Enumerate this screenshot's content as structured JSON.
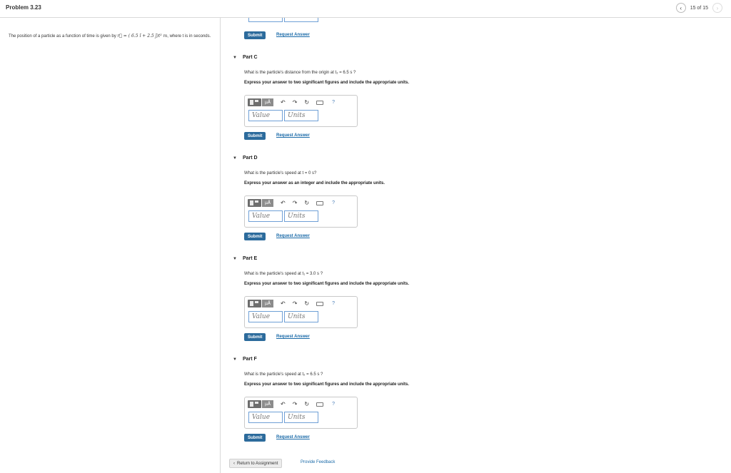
{
  "header": {
    "title": "Problem 3.23",
    "nav_prev": "‹",
    "nav_count": "15 of 15",
    "nav_next": "›"
  },
  "problem": {
    "text_before": "The position of a particle as a function of time is given by ",
    "equation": "r⃗ = ( 6.5 î + 2.5 ĵ)t² m",
    "text_after": ", where t is in seconds."
  },
  "partial_top": {
    "submit_label": "Submit",
    "request_label": "Request Answer"
  },
  "parts": [
    {
      "header": "Part C",
      "question": "What is the particle's distance from the origin at t₂ = 6.5 s ?",
      "instruction": "Express your answer to two significant figures and include the appropriate units.",
      "value_placeholder": "Value",
      "units_placeholder": "Units",
      "submit_label": "Submit",
      "request_label": "Request Answer"
    },
    {
      "header": "Part D",
      "question": "What is the particle's speed at t = 0 s?",
      "instruction": "Express your answer as an integer and include the appropriate units.",
      "value_placeholder": "Value",
      "units_placeholder": "Units",
      "submit_label": "Submit",
      "request_label": "Request Answer"
    },
    {
      "header": "Part E",
      "question": "What is the particle's speed at t₁ = 3.0 s ?",
      "instruction": "Express your answer to two significant figures and include the appropriate units.",
      "value_placeholder": "Value",
      "units_placeholder": "Units",
      "submit_label": "Submit",
      "request_label": "Request Answer"
    },
    {
      "header": "Part F",
      "question": "What is the particle's speed at t₂ = 6.5 s ?",
      "instruction": "Express your answer to two significant figures and include the appropriate units.",
      "value_placeholder": "Value",
      "units_placeholder": "Units",
      "submit_label": "Submit",
      "request_label": "Request Answer"
    }
  ],
  "toolbar": {
    "mu_label": "μÅ",
    "undo_glyph": "↶",
    "redo_glyph": "↷",
    "reset_glyph": "↻",
    "help_glyph": "?"
  },
  "footer": {
    "return_label": "Return to Assignment",
    "feedback_label": "Provide Feedback"
  }
}
